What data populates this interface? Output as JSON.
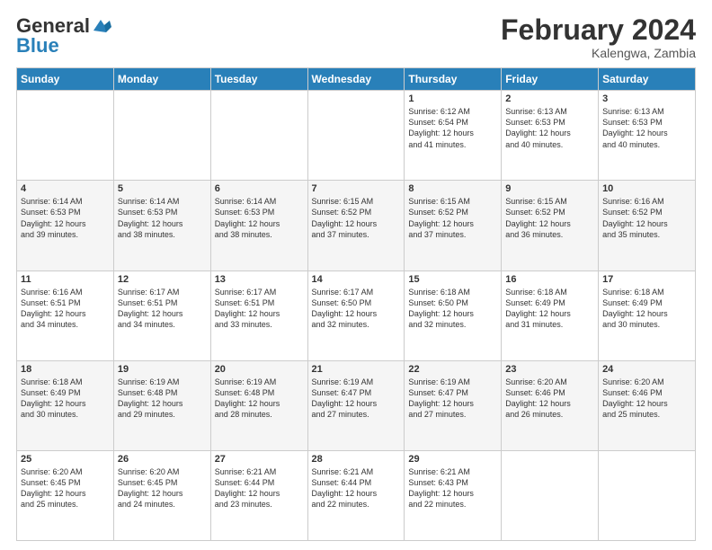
{
  "header": {
    "logo_general": "General",
    "logo_blue": "Blue",
    "month_title": "February 2024",
    "location": "Kalengwa, Zambia"
  },
  "days_of_week": [
    "Sunday",
    "Monday",
    "Tuesday",
    "Wednesday",
    "Thursday",
    "Friday",
    "Saturday"
  ],
  "weeks": [
    [
      {
        "day": "",
        "info": ""
      },
      {
        "day": "",
        "info": ""
      },
      {
        "day": "",
        "info": ""
      },
      {
        "day": "",
        "info": ""
      },
      {
        "day": "1",
        "info": "Sunrise: 6:12 AM\nSunset: 6:54 PM\nDaylight: 12 hours\nand 41 minutes."
      },
      {
        "day": "2",
        "info": "Sunrise: 6:13 AM\nSunset: 6:53 PM\nDaylight: 12 hours\nand 40 minutes."
      },
      {
        "day": "3",
        "info": "Sunrise: 6:13 AM\nSunset: 6:53 PM\nDaylight: 12 hours\nand 40 minutes."
      }
    ],
    [
      {
        "day": "4",
        "info": "Sunrise: 6:14 AM\nSunset: 6:53 PM\nDaylight: 12 hours\nand 39 minutes."
      },
      {
        "day": "5",
        "info": "Sunrise: 6:14 AM\nSunset: 6:53 PM\nDaylight: 12 hours\nand 38 minutes."
      },
      {
        "day": "6",
        "info": "Sunrise: 6:14 AM\nSunset: 6:53 PM\nDaylight: 12 hours\nand 38 minutes."
      },
      {
        "day": "7",
        "info": "Sunrise: 6:15 AM\nSunset: 6:52 PM\nDaylight: 12 hours\nand 37 minutes."
      },
      {
        "day": "8",
        "info": "Sunrise: 6:15 AM\nSunset: 6:52 PM\nDaylight: 12 hours\nand 37 minutes."
      },
      {
        "day": "9",
        "info": "Sunrise: 6:15 AM\nSunset: 6:52 PM\nDaylight: 12 hours\nand 36 minutes."
      },
      {
        "day": "10",
        "info": "Sunrise: 6:16 AM\nSunset: 6:52 PM\nDaylight: 12 hours\nand 35 minutes."
      }
    ],
    [
      {
        "day": "11",
        "info": "Sunrise: 6:16 AM\nSunset: 6:51 PM\nDaylight: 12 hours\nand 34 minutes."
      },
      {
        "day": "12",
        "info": "Sunrise: 6:17 AM\nSunset: 6:51 PM\nDaylight: 12 hours\nand 34 minutes."
      },
      {
        "day": "13",
        "info": "Sunrise: 6:17 AM\nSunset: 6:51 PM\nDaylight: 12 hours\nand 33 minutes."
      },
      {
        "day": "14",
        "info": "Sunrise: 6:17 AM\nSunset: 6:50 PM\nDaylight: 12 hours\nand 32 minutes."
      },
      {
        "day": "15",
        "info": "Sunrise: 6:18 AM\nSunset: 6:50 PM\nDaylight: 12 hours\nand 32 minutes."
      },
      {
        "day": "16",
        "info": "Sunrise: 6:18 AM\nSunset: 6:49 PM\nDaylight: 12 hours\nand 31 minutes."
      },
      {
        "day": "17",
        "info": "Sunrise: 6:18 AM\nSunset: 6:49 PM\nDaylight: 12 hours\nand 30 minutes."
      }
    ],
    [
      {
        "day": "18",
        "info": "Sunrise: 6:18 AM\nSunset: 6:49 PM\nDaylight: 12 hours\nand 30 minutes."
      },
      {
        "day": "19",
        "info": "Sunrise: 6:19 AM\nSunset: 6:48 PM\nDaylight: 12 hours\nand 29 minutes."
      },
      {
        "day": "20",
        "info": "Sunrise: 6:19 AM\nSunset: 6:48 PM\nDaylight: 12 hours\nand 28 minutes."
      },
      {
        "day": "21",
        "info": "Sunrise: 6:19 AM\nSunset: 6:47 PM\nDaylight: 12 hours\nand 27 minutes."
      },
      {
        "day": "22",
        "info": "Sunrise: 6:19 AM\nSunset: 6:47 PM\nDaylight: 12 hours\nand 27 minutes."
      },
      {
        "day": "23",
        "info": "Sunrise: 6:20 AM\nSunset: 6:46 PM\nDaylight: 12 hours\nand 26 minutes."
      },
      {
        "day": "24",
        "info": "Sunrise: 6:20 AM\nSunset: 6:46 PM\nDaylight: 12 hours\nand 25 minutes."
      }
    ],
    [
      {
        "day": "25",
        "info": "Sunrise: 6:20 AM\nSunset: 6:45 PM\nDaylight: 12 hours\nand 25 minutes."
      },
      {
        "day": "26",
        "info": "Sunrise: 6:20 AM\nSunset: 6:45 PM\nDaylight: 12 hours\nand 24 minutes."
      },
      {
        "day": "27",
        "info": "Sunrise: 6:21 AM\nSunset: 6:44 PM\nDaylight: 12 hours\nand 23 minutes."
      },
      {
        "day": "28",
        "info": "Sunrise: 6:21 AM\nSunset: 6:44 PM\nDaylight: 12 hours\nand 22 minutes."
      },
      {
        "day": "29",
        "info": "Sunrise: 6:21 AM\nSunset: 6:43 PM\nDaylight: 12 hours\nand 22 minutes."
      },
      {
        "day": "",
        "info": ""
      },
      {
        "day": "",
        "info": ""
      }
    ]
  ]
}
